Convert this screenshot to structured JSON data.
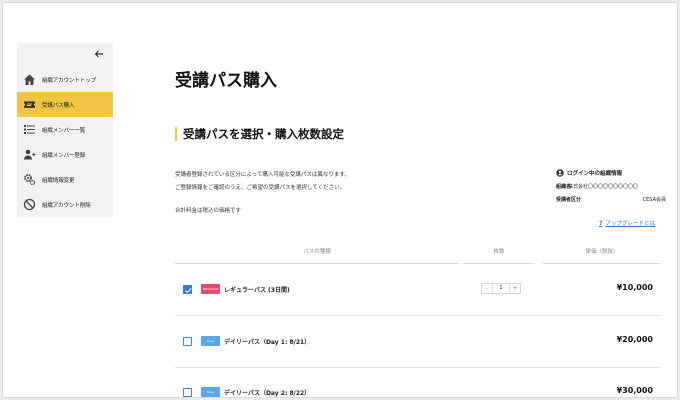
{
  "sidebar": {
    "items": [
      {
        "label": "組織アカウントトップ",
        "icon": "home-icon"
      },
      {
        "label": "受講パス購入",
        "icon": "ticket-icon",
        "active": true
      },
      {
        "label": "組織メンバー一覧",
        "icon": "list-icon"
      },
      {
        "label": "組織メンバー登録",
        "icon": "add-user-icon"
      },
      {
        "label": "組織情報変更",
        "icon": "gear-icon"
      },
      {
        "label": "組織アカウント削除",
        "icon": "prohibited-icon"
      }
    ]
  },
  "page": {
    "title": "受講パス購入",
    "section_title": "受講パスを選択・購入枚数設定",
    "description": [
      "受講者登録されている区分によって購入可能な受講パスは異なります。",
      "ご登録情報をご確認のうえ、ご希望の受講パスを選択してください。"
    ],
    "tax_note": "合計料金は税込の価格です"
  },
  "login_info": {
    "heading": "ログイン中の組織情報",
    "org_label": "組織名",
    "org_value": "株式会社〇〇〇〇〇〇〇〇〇〇",
    "category_label": "受講者区分",
    "category_value": "CESA会員"
  },
  "help_link": {
    "icon": "?",
    "label": "アップグレードとは"
  },
  "table": {
    "headers": {
      "type": "パスの種類",
      "count": "枚数",
      "price": "単価（税抜）"
    },
    "rows": [
      {
        "checked": true,
        "ticket_color": "#e84a6f",
        "ticket_text": "REGULAR",
        "name": "レギュラーパス (3日間)",
        "quantity": "1",
        "price": "¥10,000"
      },
      {
        "checked": false,
        "ticket_color": "#5aa6e6",
        "ticket_text": "Daily",
        "name": "デイリーパス（Day 1: 8/21）",
        "price": "¥20,000"
      },
      {
        "checked": false,
        "ticket_color": "#5aa6e6",
        "ticket_text": "Daily",
        "name": "デイリーパス（Day 2: 8/22）",
        "price": "¥30,000"
      }
    ],
    "stepper": {
      "minus": "-",
      "plus": "+"
    }
  },
  "colors": {
    "accent": "#f0c544",
    "link": "#2f76c6",
    "checkbox": "#3a76d6"
  }
}
